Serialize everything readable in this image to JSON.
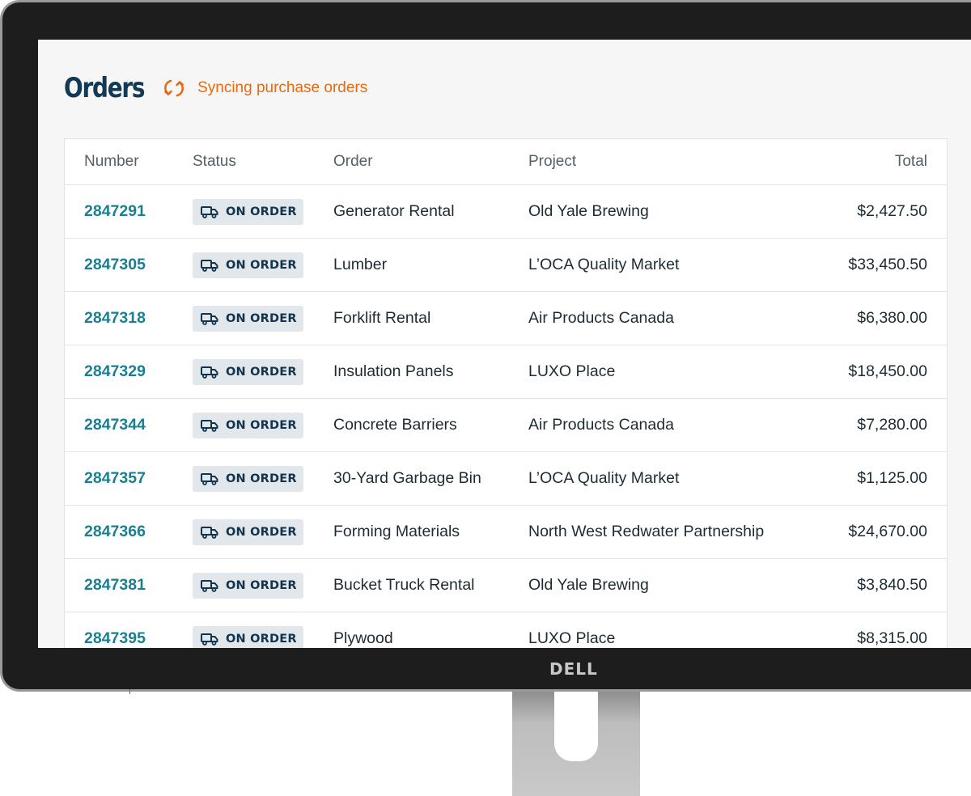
{
  "header": {
    "title": "Orders",
    "sync_status": "Syncing purchase orders"
  },
  "colors": {
    "title": "#123a55",
    "sync": "#e86a10",
    "link": "#1b7f8f",
    "badge_bg": "#e2e7eb",
    "badge_text": "#13344d"
  },
  "table": {
    "columns": {
      "number": "Number",
      "status": "Status",
      "order": "Order",
      "project": "Project",
      "total": "Total"
    },
    "rows": [
      {
        "number": "2847291",
        "status": "ON ORDER",
        "order": "Generator Rental",
        "project": "Old Yale Brewing",
        "total": "$2,427.50"
      },
      {
        "number": "2847305",
        "status": "ON ORDER",
        "order": "Lumber",
        "project": "L’OCA Quality Market",
        "total": "$33,450.50"
      },
      {
        "number": "2847318",
        "status": "ON ORDER",
        "order": "Forklift Rental",
        "project": "Air Products Canada",
        "total": "$6,380.00"
      },
      {
        "number": "2847329",
        "status": "ON ORDER",
        "order": "Insulation Panels",
        "project": "LUXO Place",
        "total": "$18,450.00"
      },
      {
        "number": "2847344",
        "status": "ON ORDER",
        "order": "Concrete Barriers",
        "project": "Air Products Canada",
        "total": "$7,280.00"
      },
      {
        "number": "2847357",
        "status": "ON ORDER",
        "order": "30-Yard Garbage Bin",
        "project": "L’OCA Quality Market",
        "total": "$1,125.00"
      },
      {
        "number": "2847366",
        "status": "ON ORDER",
        "order": "Forming Materials",
        "project": "North West Redwater Partnership",
        "total": "$24,670.00"
      },
      {
        "number": "2847381",
        "status": "ON ORDER",
        "order": "Bucket Truck Rental",
        "project": "Old Yale Brewing",
        "total": "$3,840.50"
      },
      {
        "number": "2847395",
        "status": "ON ORDER",
        "order": "Plywood",
        "project": "LUXO Place",
        "total": "$8,315.00"
      }
    ]
  },
  "icons": {
    "sync": "sync-icon",
    "status": "truck-icon"
  },
  "hardware": {
    "brand": "DELL"
  }
}
